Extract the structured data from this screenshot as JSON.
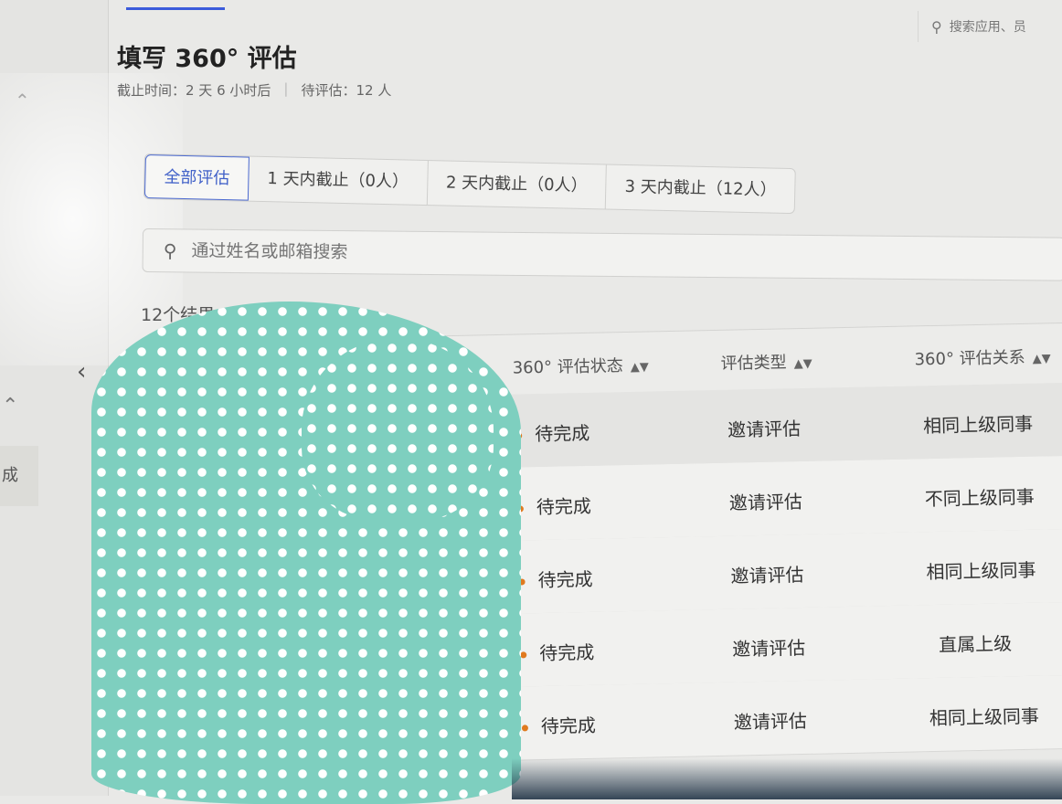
{
  "header": {
    "title": "填写 360° 评估",
    "deadline_label": "截止时间：2 天 6 小时后",
    "pending_label": "待评估：12 人",
    "search_placeholder": "搜索应用、员"
  },
  "sidebar": {
    "item_label": "成"
  },
  "filter_tabs": [
    {
      "label": "全部评估",
      "active": true
    },
    {
      "label": "1 天内截止（0人）",
      "active": false
    },
    {
      "label": "2 天内截止（0人）",
      "active": false
    },
    {
      "label": "3 天内截止（12人）",
      "active": false
    }
  ],
  "search": {
    "placeholder": "通过姓名或邮箱搜索"
  },
  "result_count": "12个结果",
  "table": {
    "columns": [
      {
        "label": "360° 评估状态"
      },
      {
        "label": "评估类型"
      },
      {
        "label": "360° 评估关系"
      }
    ],
    "rows": [
      {
        "status": "待完成",
        "type": "邀请评估",
        "relation": "相同上级同事"
      },
      {
        "status": "待完成",
        "type": "邀请评估",
        "relation": "不同上级同事"
      },
      {
        "status": "待完成",
        "type": "邀请评估",
        "relation": "相同上级同事"
      },
      {
        "status": "待完成",
        "type": "邀请评估",
        "relation": "直属上级"
      },
      {
        "status": "待完成",
        "type": "邀请评估",
        "relation": "相同上级同事"
      }
    ]
  },
  "colors": {
    "accent": "#4060c8",
    "status_dot": "#e07a1f",
    "redaction": "#7ecfbf"
  },
  "icons": {
    "search": "search-icon",
    "sort": "sort-icon",
    "collapse": "chevron-left-icon",
    "cursor": "hand-cursor-icon"
  }
}
